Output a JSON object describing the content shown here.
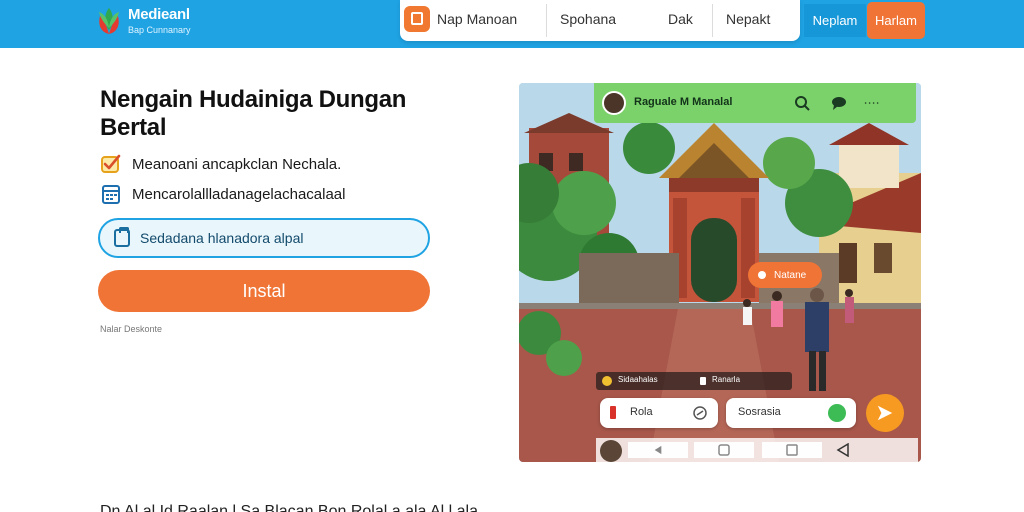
{
  "header": {
    "logo_title": "Medieanl",
    "logo_subtitle": "Bap Cunnanary",
    "nav": [
      "Nap Manoan",
      "Spohana",
      "Dak",
      "Nepakt"
    ],
    "btn_primary": "Neplam",
    "btn_orange": "Harlam"
  },
  "hero": {
    "title": "Nengain Hudainiga Dungan Bertal",
    "features": [
      {
        "text": "Meanoani ancapkclan Nechala.",
        "icon": "checkbox-icon"
      },
      {
        "text": "Mencarolallladanagelachacalaal",
        "icon": "calendar-icon"
      }
    ],
    "outline_button": "Sedadana hlanadora alpal",
    "install_button": "Instal",
    "note": "Nalar Deskonte"
  },
  "preview": {
    "chat_title": "Raguale M Manalal",
    "badge": "Natane",
    "info_left": "Sidaahalas",
    "info_right": "Ranarla",
    "chip_left": "Rola",
    "chip_right": "Sosrasia",
    "colors": {
      "green": "#7cd26a",
      "orange": "#f07436",
      "blue": "#1fa3e3"
    }
  },
  "footer_line": "Dn                                            Al    al   Id   Raalan    l    Sa  Blacan  Bon Rolal  a ala  Al   l  ala"
}
